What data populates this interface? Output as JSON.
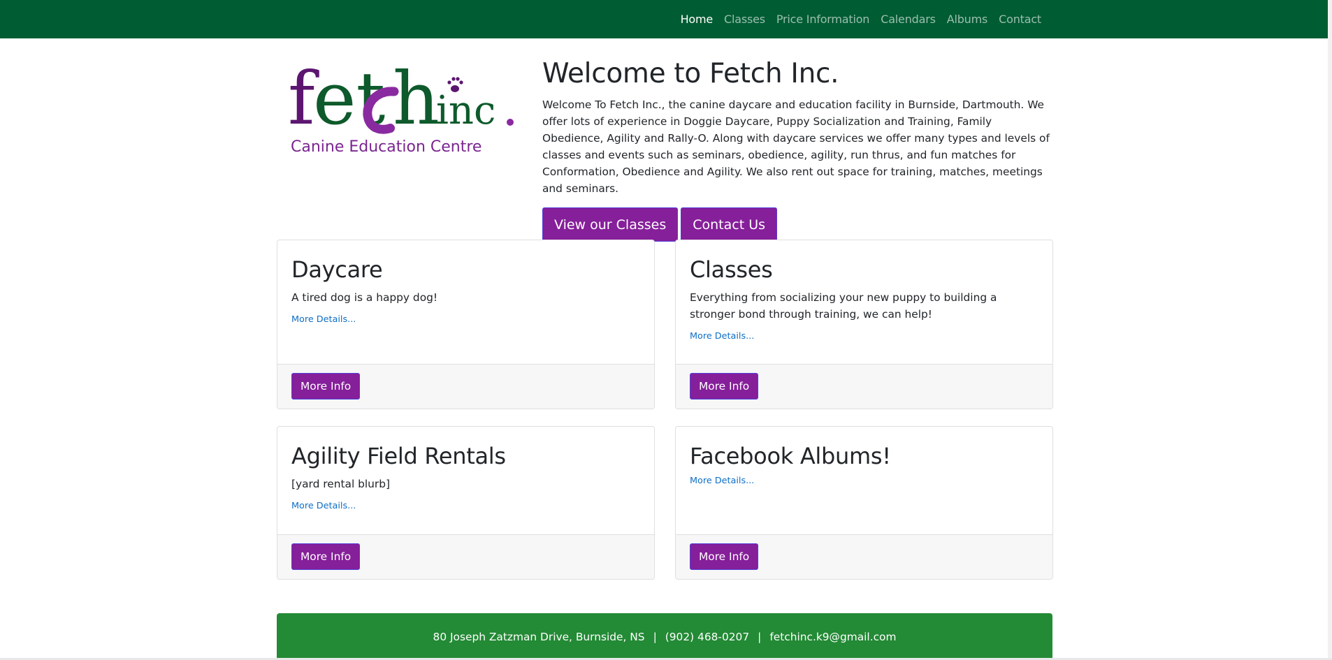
{
  "nav": {
    "items": [
      {
        "label": "Home",
        "active": true
      },
      {
        "label": "Classes",
        "active": false
      },
      {
        "label": "Price Information",
        "active": false
      },
      {
        "label": "Calendars",
        "active": false
      },
      {
        "label": "Albums",
        "active": false
      },
      {
        "label": "Contact",
        "active": false
      }
    ]
  },
  "logo": {
    "brand": "fetch inc.",
    "tagline": "Canine Education Centre"
  },
  "hero": {
    "title": "Welcome to Fetch Inc.",
    "description": "Welcome To Fetch Inc., the canine daycare and education facility in Burnside, Dartmouth. We offer lots of experience in Doggie Daycare, Puppy Socialization and Training, Family Obedience, Agility and Rally-O. Along with daycare services we offer many types and levels of classes and events such as seminars, obedience, agility, run thrus, and fun matches for Conformation, Obedience and Agility. We also rent out space for training, matches, meetings and seminars.",
    "primary_button": "View our Classes",
    "secondary_button": "Contact Us"
  },
  "cards": [
    {
      "title": "Daycare",
      "text": "A tired dog is a happy dog!",
      "link": "More Details...",
      "button": "More Info"
    },
    {
      "title": "Classes",
      "text": "Everything from socializing your new puppy to building a stronger bond through training, we can help!",
      "link": "More Details...",
      "button": "More Info"
    },
    {
      "title": "Agility Field Rentals",
      "text": "[yard rental blurb]",
      "link": "More Details...",
      "button": "More Info"
    },
    {
      "title": "Facebook Albums!",
      "text": "",
      "link": "More Details...",
      "button": "More Info"
    }
  ],
  "footer": {
    "address": "80 Joseph Zatzman Drive, Burnside, NS",
    "phone": "(902) 468-0207",
    "email": "fetchinc.k9@gmail.com",
    "separator": "|"
  },
  "colors": {
    "navbar": "#005c32",
    "accent_purple": "#861f9a",
    "footer_green": "#238a35",
    "logo_green": "#0e5a2c",
    "link_blue": "#0f6fc5"
  }
}
